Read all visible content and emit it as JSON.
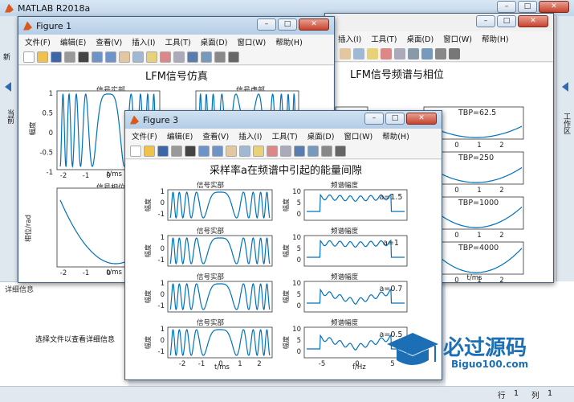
{
  "main_window": {
    "title": "MATLAB R2018a",
    "sidebar_left": "当前",
    "sidebar_right": "工作区",
    "detail_title": "详细信息",
    "detail_text": "选择文件以查看详细信息",
    "status_row_label": "行",
    "status_row": "1",
    "status_col_label": "列",
    "status_col": "1",
    "left_strip": "新"
  },
  "watermark": {
    "text": "必过源码",
    "url": "Biguo100.com"
  },
  "menu": [
    "文件(F)",
    "编辑(E)",
    "查看(V)",
    "插入(I)",
    "工具(T)",
    "桌面(D)",
    "窗口(W)",
    "帮助(H)"
  ],
  "fig1": {
    "title": "Figure 1",
    "heading": "LFM信号仿真",
    "p1_title": "信号实部",
    "p2_title": "信号虚部",
    "p3_title": "信号相位",
    "ylabel_amp": "幅度",
    "ylabel_phase": "相位/rad",
    "xlabel": "t/ms",
    "yticks": [
      "1",
      "0.5",
      "0",
      "-0.5",
      "-1"
    ],
    "xticks": [
      "-2",
      "-1",
      "0",
      "1",
      "2"
    ]
  },
  "fig2": {
    "title": "Figure 2",
    "heading": "LFM信号频谱与相位",
    "ylabel": "/rad",
    "xlabel": "t/ms",
    "tbp": [
      "TBP=62.5",
      "TBP=250",
      "TBP=1000",
      "TBP=4000"
    ],
    "xticks": [
      "-1",
      "0",
      "1",
      "2"
    ]
  },
  "fig3": {
    "title": "Figure 3",
    "heading": "采样率a在频谱中引起的能量间隙",
    "left_title": "信号实部",
    "right_title": "频谱幅度",
    "ylabel": "幅度",
    "xlabel_left": "t/ms",
    "xlabel_right": "f/Hz",
    "a_labels": [
      "a=1.5",
      "a=1",
      "a=0.7",
      "a=0.5"
    ],
    "yticks": [
      "1",
      "0",
      "-1"
    ],
    "spec_yticks": [
      "10",
      "5",
      "0"
    ],
    "xticks": [
      "-2",
      "-1",
      "0",
      "1",
      "2"
    ],
    "spec_xticks": [
      "-5",
      "0",
      "5"
    ]
  }
}
